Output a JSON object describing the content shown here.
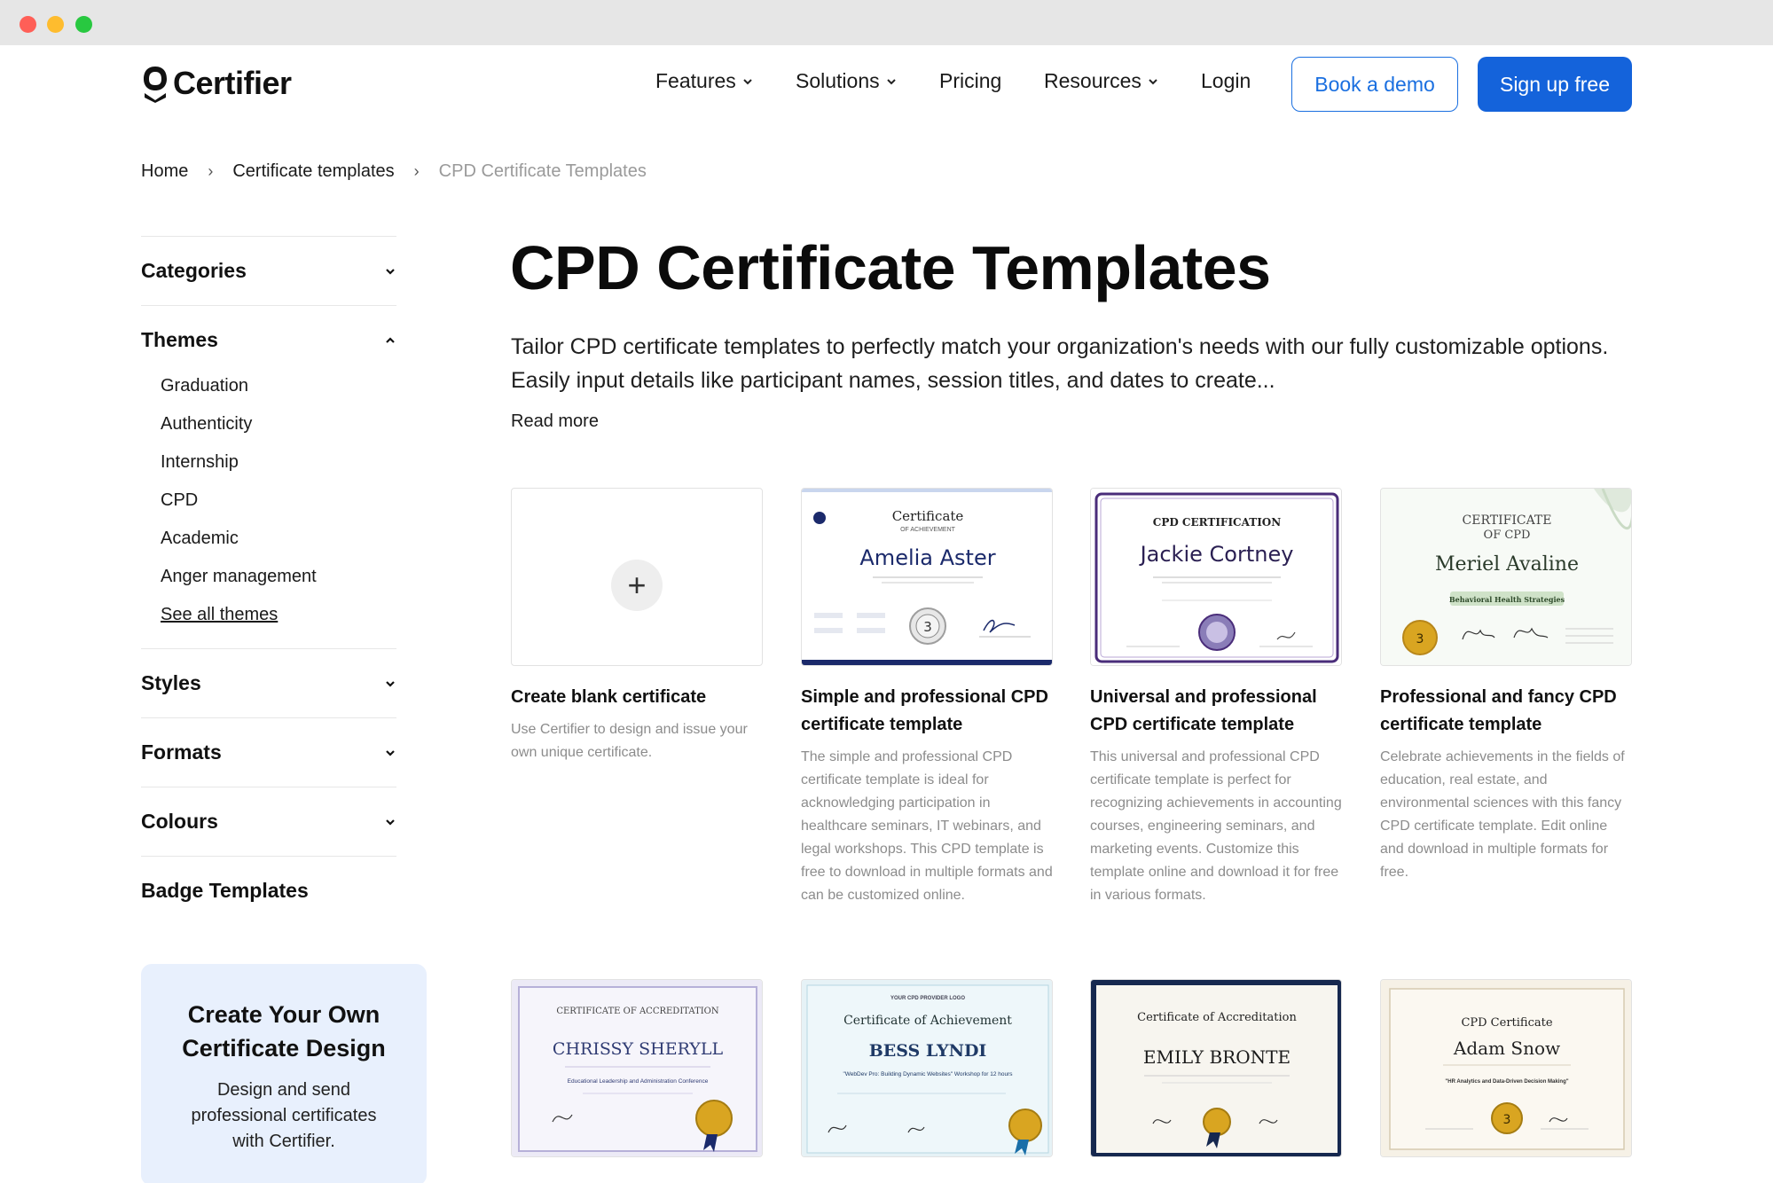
{
  "brand": {
    "name": "Certifier"
  },
  "nav": {
    "features": "Features",
    "solutions": "Solutions",
    "pricing": "Pricing",
    "resources": "Resources",
    "login": "Login",
    "book_demo": "Book a demo",
    "sign_up": "Sign up free"
  },
  "breadcrumb": {
    "home": "Home",
    "templates": "Certificate templates",
    "current": "CPD Certificate Templates",
    "separator": "›"
  },
  "sidebar": {
    "categories": "Categories",
    "themes": "Themes",
    "theme_items": [
      "Graduation",
      "Authenticity",
      "Internship",
      "CPD",
      "Academic",
      "Anger management"
    ],
    "see_all": "See all themes",
    "styles": "Styles",
    "formats": "Formats",
    "colours": "Colours",
    "badge_templates": "Badge Templates"
  },
  "promo": {
    "title": "Create Your Own Certificate Design",
    "text": "Design and send professional certificates with Certifier."
  },
  "main": {
    "title": "CPD Certificate Templates",
    "intro": "Tailor CPD certificate templates to perfectly match your organization's needs with our fully customizable options. Easily input details like participant names, session titles, and dates to create...",
    "read_more": "Read more"
  },
  "cards": [
    {
      "title": "Create blank certificate",
      "desc": "Use Certifier to design and issue your own unique certificate.",
      "plus": "+"
    },
    {
      "title": "Simple and professional CPD certificate template",
      "desc": "The simple and professional CPD certificate template is ideal for acknowledging participation in healthcare seminars, IT webinars, and legal workshops. This CPD template is free to download in multiple formats and can be customized online.",
      "thumb": {
        "heading": "Certificate",
        "sub": "OF ACHIEVEMENT",
        "name": "Amelia Aster",
        "seal": "3"
      }
    },
    {
      "title": "Universal and professional CPD certificate template",
      "desc": "This universal and professional CPD certificate template is perfect for recognizing achievements in accounting courses, engineering seminars, and marketing events. Customize this template online and download it for free in various formats.",
      "thumb": {
        "heading": "CPD CERTIFICATION",
        "name": "Jackie Cortney"
      }
    },
    {
      "title": "Professional and fancy CPD certificate template",
      "desc": "Celebrate achievements in the fields of education, real estate, and environmental sciences with this fancy CPD certificate template. Edit online and download in multiple formats for free.",
      "thumb": {
        "heading": "CERTIFICATE",
        "sub": "OF CPD",
        "name": "Meriel Avaline",
        "ribbon": "Behavioral Health Strategies",
        "seal": "3"
      }
    },
    {
      "thumb": {
        "heading": "CERTIFICATE OF ACCREDITATION",
        "name": "CHRISSY SHERYLL",
        "event": "Educational Leadership and Administration Conference"
      }
    },
    {
      "thumb": {
        "logo": "YOUR CPD PROVIDER LOGO",
        "heading": "Certificate of Achievement",
        "name": "BESS LYNDI",
        "event": "\"WebDev Pro: Building Dynamic Websites\" Workshop for 12 hours"
      }
    },
    {
      "thumb": {
        "heading": "Certificate of Accreditation",
        "name": "EMILY BRONTE"
      }
    },
    {
      "thumb": {
        "heading": "CPD Certificate",
        "name": "Adam Snow",
        "event": "\"HR Analytics and Data-Driven Decision Making\"",
        "seal": "3"
      }
    }
  ],
  "colors": {
    "primary": "#1463db",
    "promo_bg": "#e8f0fd",
    "navy": "#1b2a6b",
    "purple": "#4a2d7a",
    "gold": "#d9a521"
  }
}
